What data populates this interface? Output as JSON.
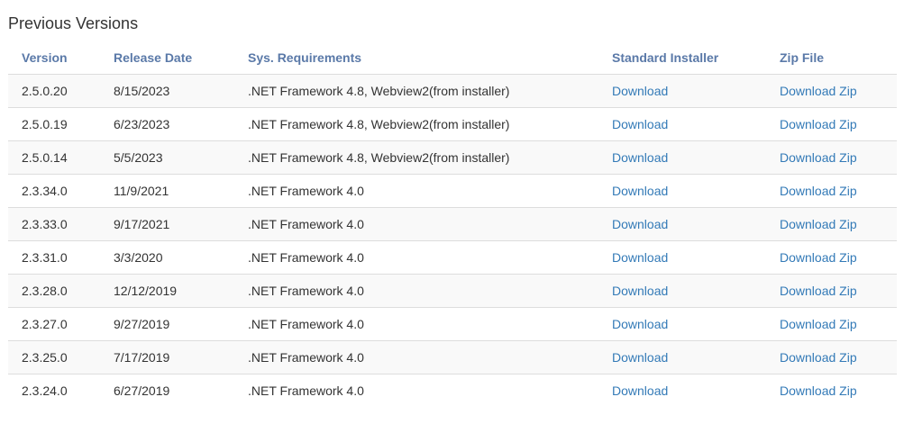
{
  "page": {
    "title": "Previous Versions"
  },
  "table": {
    "headers": {
      "version": "Version",
      "release_date": "Release Date",
      "requirements": "Sys. Requirements",
      "installer": "Standard Installer",
      "zip": "Zip File"
    },
    "rows": [
      {
        "version": "2.5.0.20",
        "release_date": "8/15/2023",
        "requirements": ".NET Framework 4.8, Webview2(from installer)",
        "installer": "Download",
        "zip": "Download Zip"
      },
      {
        "version": "2.5.0.19",
        "release_date": "6/23/2023",
        "requirements": ".NET Framework 4.8, Webview2(from installer)",
        "installer": "Download",
        "zip": "Download Zip"
      },
      {
        "version": "2.5.0.14",
        "release_date": "5/5/2023",
        "requirements": ".NET Framework 4.8, Webview2(from installer)",
        "installer": "Download",
        "zip": "Download Zip"
      },
      {
        "version": "2.3.34.0",
        "release_date": "11/9/2021",
        "requirements": ".NET Framework 4.0",
        "installer": "Download",
        "zip": "Download Zip"
      },
      {
        "version": "2.3.33.0",
        "release_date": "9/17/2021",
        "requirements": ".NET Framework 4.0",
        "installer": "Download",
        "zip": "Download Zip"
      },
      {
        "version": "2.3.31.0",
        "release_date": "3/3/2020",
        "requirements": ".NET Framework 4.0",
        "installer": "Download",
        "zip": "Download Zip"
      },
      {
        "version": "2.3.28.0",
        "release_date": "12/12/2019",
        "requirements": ".NET Framework 4.0",
        "installer": "Download",
        "zip": "Download Zip"
      },
      {
        "version": "2.3.27.0",
        "release_date": "9/27/2019",
        "requirements": ".NET Framework 4.0",
        "installer": "Download",
        "zip": "Download Zip"
      },
      {
        "version": "2.3.25.0",
        "release_date": "7/17/2019",
        "requirements": ".NET Framework 4.0",
        "installer": "Download",
        "zip": "Download Zip"
      },
      {
        "version": "2.3.24.0",
        "release_date": "6/27/2019",
        "requirements": ".NET Framework 4.0",
        "installer": "Download",
        "zip": "Download Zip"
      }
    ]
  },
  "colors": {
    "header_text": "#5a79a8",
    "link": "#337ab7",
    "stripe": "#f9f9f9",
    "border": "#dddddd"
  }
}
